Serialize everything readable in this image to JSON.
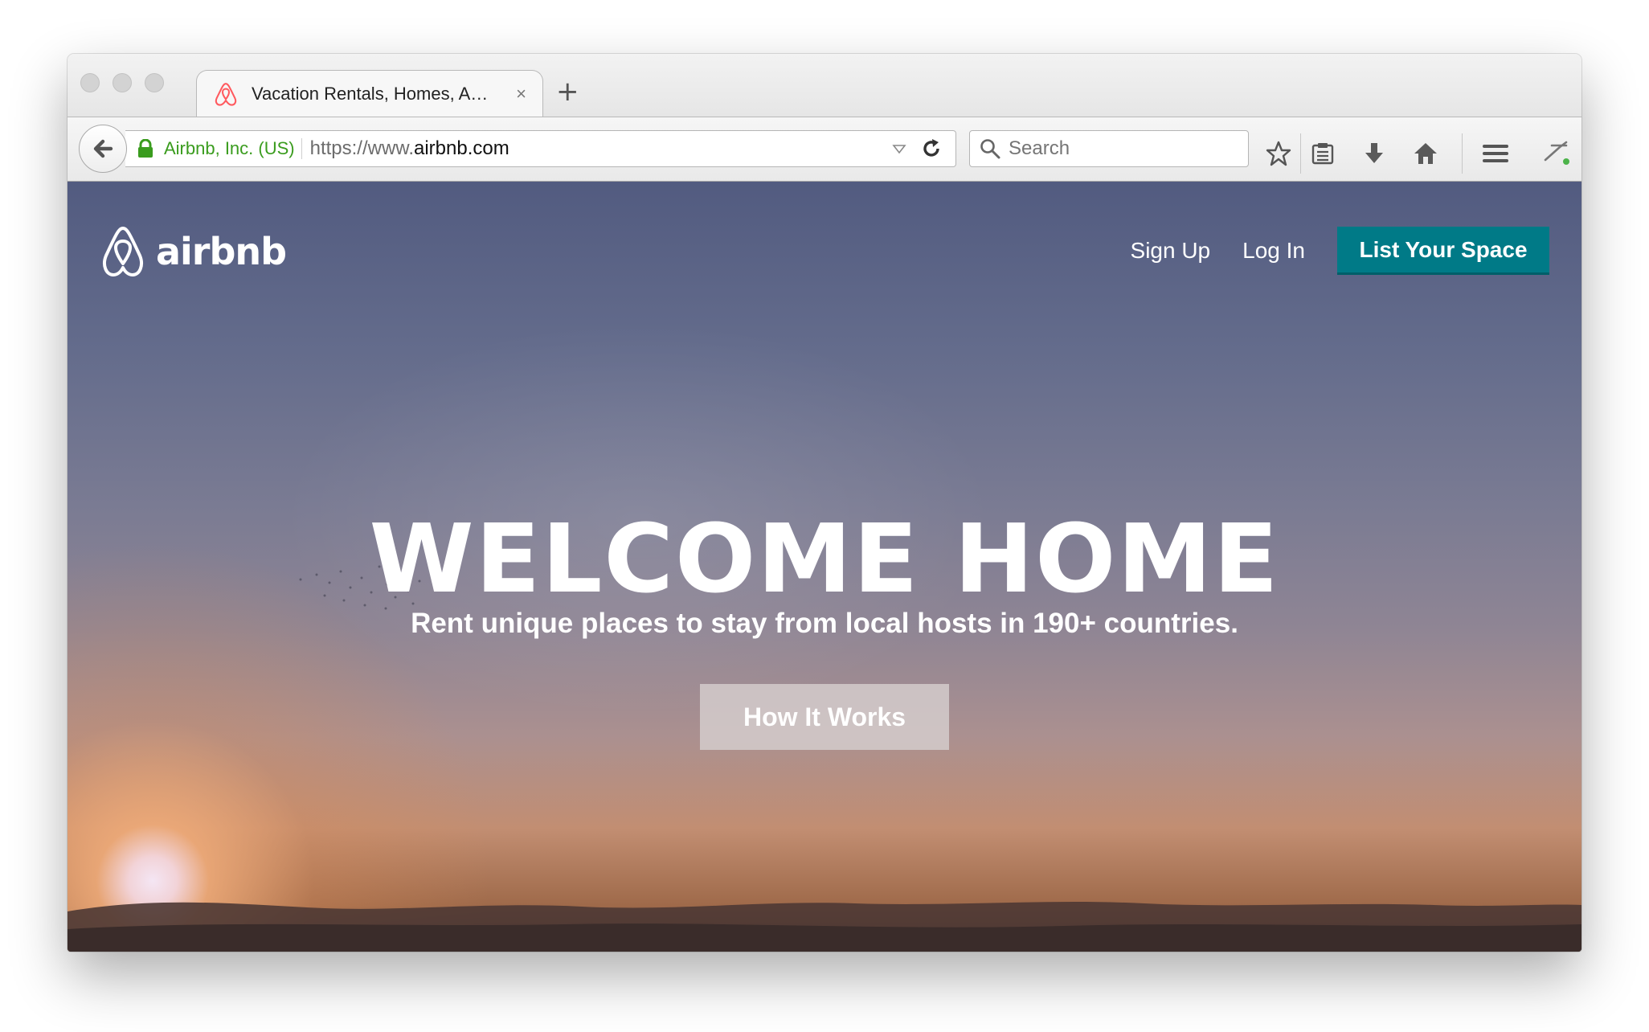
{
  "browser": {
    "tab": {
      "title": "Vacation Rentals, Homes, A…",
      "favicon": "airbnb-logo-icon",
      "close": "×"
    },
    "new_tab": "+",
    "nav": {
      "identity": "Airbnb, Inc. (US)",
      "url_prefix": "https://www.",
      "url_host": "airbnb.com",
      "search_placeholder": "Search"
    },
    "toolbar_icons": [
      "star-icon",
      "reading-list-icon",
      "download-icon",
      "home-icon",
      "menu-icon",
      "developer-icon"
    ]
  },
  "page": {
    "brand_name": "airbnb",
    "nav_links": {
      "sign_up": "Sign Up",
      "log_in": "Log In",
      "list_space": "List Your Space"
    },
    "hero": {
      "title": "WELCOME HOME",
      "subtitle": "Rent unique places to stay from local hosts in 190+ countries.",
      "button": "How It Works"
    }
  },
  "colors": {
    "cta_teal": "#007a87",
    "secure_green": "#3a9c1e",
    "airbnb_red": "#ff5a5f"
  }
}
